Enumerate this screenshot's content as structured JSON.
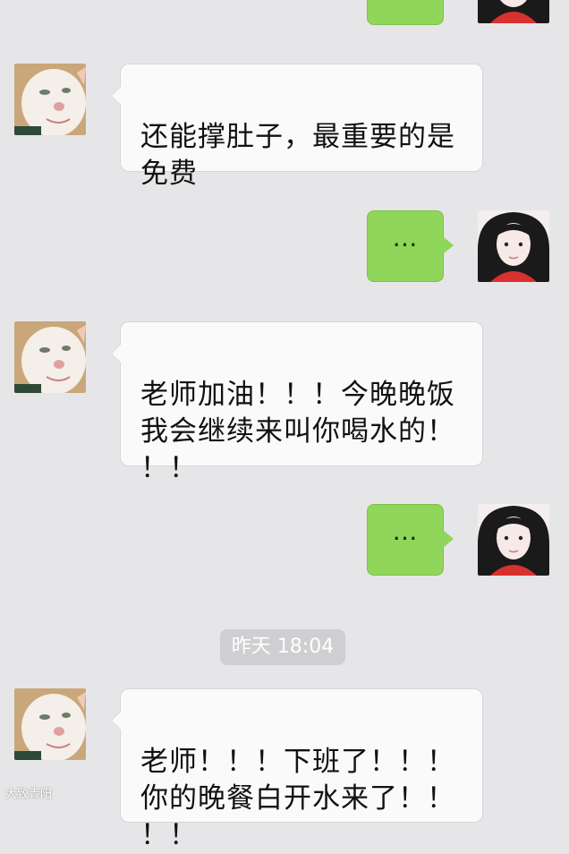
{
  "messages": {
    "m1": {
      "text": "…"
    },
    "m2": {
      "text": "还能撑肚子，最重要的是\n免费"
    },
    "m3": {
      "text": "…"
    },
    "m4": {
      "text": "老师加油！！！今晚晚饭\n我会继续来叫你喝水的！\n！！"
    },
    "m5": {
      "text": "…"
    },
    "m6": {
      "text": "老师！！！下班了！！！\n你的晚餐白开水来了！！\n！！"
    }
  },
  "timestamp": "昨天 18:04",
  "watermark": "大致青阳",
  "colors": {
    "background": "#e6e6e8",
    "incoming_bubble": "#fafafa",
    "outgoing_bubble": "#8fd65a",
    "timestamp_bg": "#cfcfd2"
  },
  "icons": {
    "incoming_avatar": "cat-avatar",
    "outgoing_avatar": "girl-avatar"
  }
}
